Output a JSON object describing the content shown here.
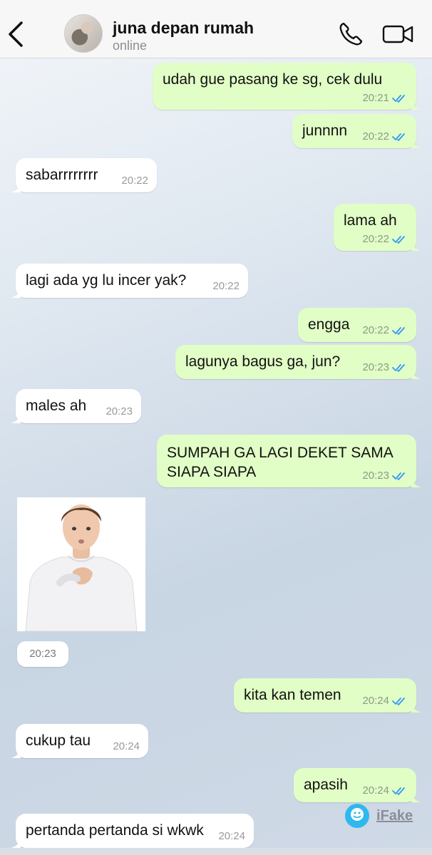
{
  "header": {
    "contact_name": "juna depan rumah",
    "status": "online"
  },
  "messages": [
    {
      "text": "udah gue pasang ke sg, cek dulu",
      "time": "20:21",
      "direction": "out"
    },
    {
      "text": "junnnn",
      "time": "20:22",
      "direction": "out"
    },
    {
      "text": "sabarrrrrrrr",
      "time": "20:22",
      "direction": "in"
    },
    {
      "text": "lama ah",
      "time": "20:22",
      "direction": "out"
    },
    {
      "text": "lagi ada yg lu incer yak?",
      "time": "20:22",
      "direction": "in"
    },
    {
      "text": "engga",
      "time": "20:22",
      "direction": "out"
    },
    {
      "text": "lagunya bagus ga, jun?",
      "time": "20:23",
      "direction": "out"
    },
    {
      "text": "males ah",
      "time": "20:23",
      "direction": "in"
    },
    {
      "text": "SUMPAH GA LAGI DEKET SAMA SIAPA SIAPA",
      "time": "20:23",
      "direction": "out"
    },
    {
      "type": "image",
      "time": "20:23",
      "direction": "in"
    },
    {
      "text": "kita kan temen",
      "time": "20:24",
      "direction": "out"
    },
    {
      "text": "cukup tau",
      "time": "20:24",
      "direction": "in"
    },
    {
      "text": "apasih",
      "time": "20:24",
      "direction": "out"
    },
    {
      "text": "pertanda pertanda si wkwk",
      "time": "20:24",
      "direction": "in"
    }
  ],
  "watermark": {
    "label": "iFake"
  },
  "colors": {
    "outgoing_bubble": "#e1fec6",
    "incoming_bubble": "#ffffff",
    "read_ticks": "#3497f9"
  },
  "icons": [
    "chevron-left-icon",
    "phone-icon",
    "video-camera-icon",
    "double-check-icon"
  ]
}
